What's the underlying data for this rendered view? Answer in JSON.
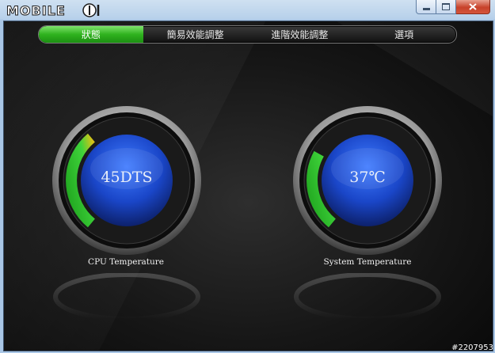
{
  "app": {
    "logo_text": "MOBILE01"
  },
  "window_controls": {
    "minimize_glyph": "—",
    "maximize_glyph": "□",
    "close_glyph": "✕"
  },
  "nav": {
    "tabs": [
      {
        "label": "狀態",
        "active": true
      },
      {
        "label": "簡易效能調整",
        "active": false
      },
      {
        "label": "進階效能調整",
        "active": false
      },
      {
        "label": "選項",
        "active": false
      }
    ]
  },
  "gauges": [
    {
      "id": "cpu",
      "value": "45DTS",
      "label": "CPU Temperature",
      "level": 0.28
    },
    {
      "id": "system",
      "value": "37℃",
      "label": "System Temperature",
      "level": 0.22
    }
  ],
  "colors": {
    "accent": "#2fb21e",
    "gauge_blue": "#1c4fd4",
    "arc_green": "#2ecc2e",
    "arc_yellow": "#d4c21a"
  },
  "watermark": "#2207953"
}
